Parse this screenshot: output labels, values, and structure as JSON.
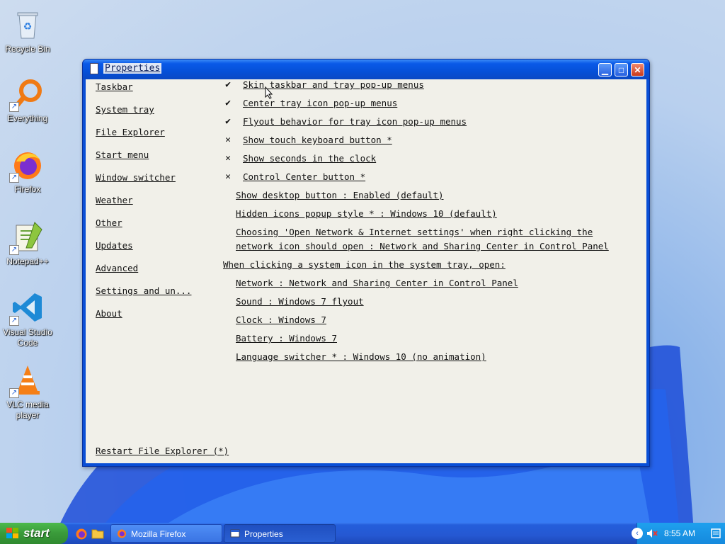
{
  "desktop": {
    "icons": [
      {
        "label": "Recycle Bin",
        "icon": "recycle-bin-icon"
      },
      {
        "label": "Everything",
        "icon": "everything-search-icon"
      },
      {
        "label": "Firefox",
        "icon": "firefox-icon"
      },
      {
        "label": "Notepad++",
        "icon": "notepad-plus-plus-icon"
      },
      {
        "label": "Visual Studio Code",
        "icon": "vscode-icon"
      },
      {
        "label": "VLC media player",
        "icon": "vlc-icon"
      }
    ]
  },
  "window": {
    "title": "Properties",
    "controls": {
      "minimize": "minimize-icon",
      "maximize": "maximize-icon",
      "close": "close-icon"
    },
    "nav": [
      "Taskbar",
      "System tray",
      "File Explorer",
      "Start menu",
      "Window switcher",
      "Weather",
      "Other",
      "Updates",
      "Advanced",
      "Settings and un...",
      "About"
    ],
    "options": [
      {
        "mark": "✔",
        "label": "Skin taskbar and tray pop-up menus"
      },
      {
        "mark": "✔",
        "label": "Center tray icon pop-up menus"
      },
      {
        "mark": "✔",
        "label": "Flyout behavior for tray icon pop-up menus"
      },
      {
        "mark": "✕",
        "label": "Show touch keyboard button *"
      },
      {
        "mark": "✕",
        "label": "Show seconds in the clock"
      },
      {
        "mark": "✕",
        "label": "Control Center button *"
      }
    ],
    "settings": [
      "Show desktop button : Enabled (default)",
      "Hidden icons popup style * : Windows 10 (default)",
      "Choosing 'Open Network & Internet settings' when right clicking the",
      "network icon should open : Network and Sharing Center in Control Panel"
    ],
    "section_heading": "When clicking a system icon in the system tray, open:",
    "tray_options": [
      "Network : Network and Sharing Center in Control Panel",
      "Sound : Windows 7 flyout",
      "Clock : Windows 7",
      "Battery : Windows 7",
      "Language switcher * : Windows 10 (no animation)"
    ],
    "restart": "Restart File Explorer (*)"
  },
  "taskbar": {
    "start_label": "start",
    "quick_launch": [
      "firefox-icon",
      "folder-icon"
    ],
    "buttons": [
      {
        "label": "Mozilla Firefox",
        "icon": "firefox-icon",
        "active": false
      },
      {
        "label": "Properties",
        "icon": "window-icon",
        "active": true
      }
    ],
    "tray": {
      "icons": [
        "chevron-left-icon",
        "speaker-muted-icon",
        "action-center-icon"
      ],
      "clock": "8:55 AM"
    }
  },
  "colors": {
    "accent": "#0a4fd6",
    "client_bg": "#f1f0e9",
    "start_green": "#3a9a3a",
    "tray_blue": "#1589dd"
  }
}
